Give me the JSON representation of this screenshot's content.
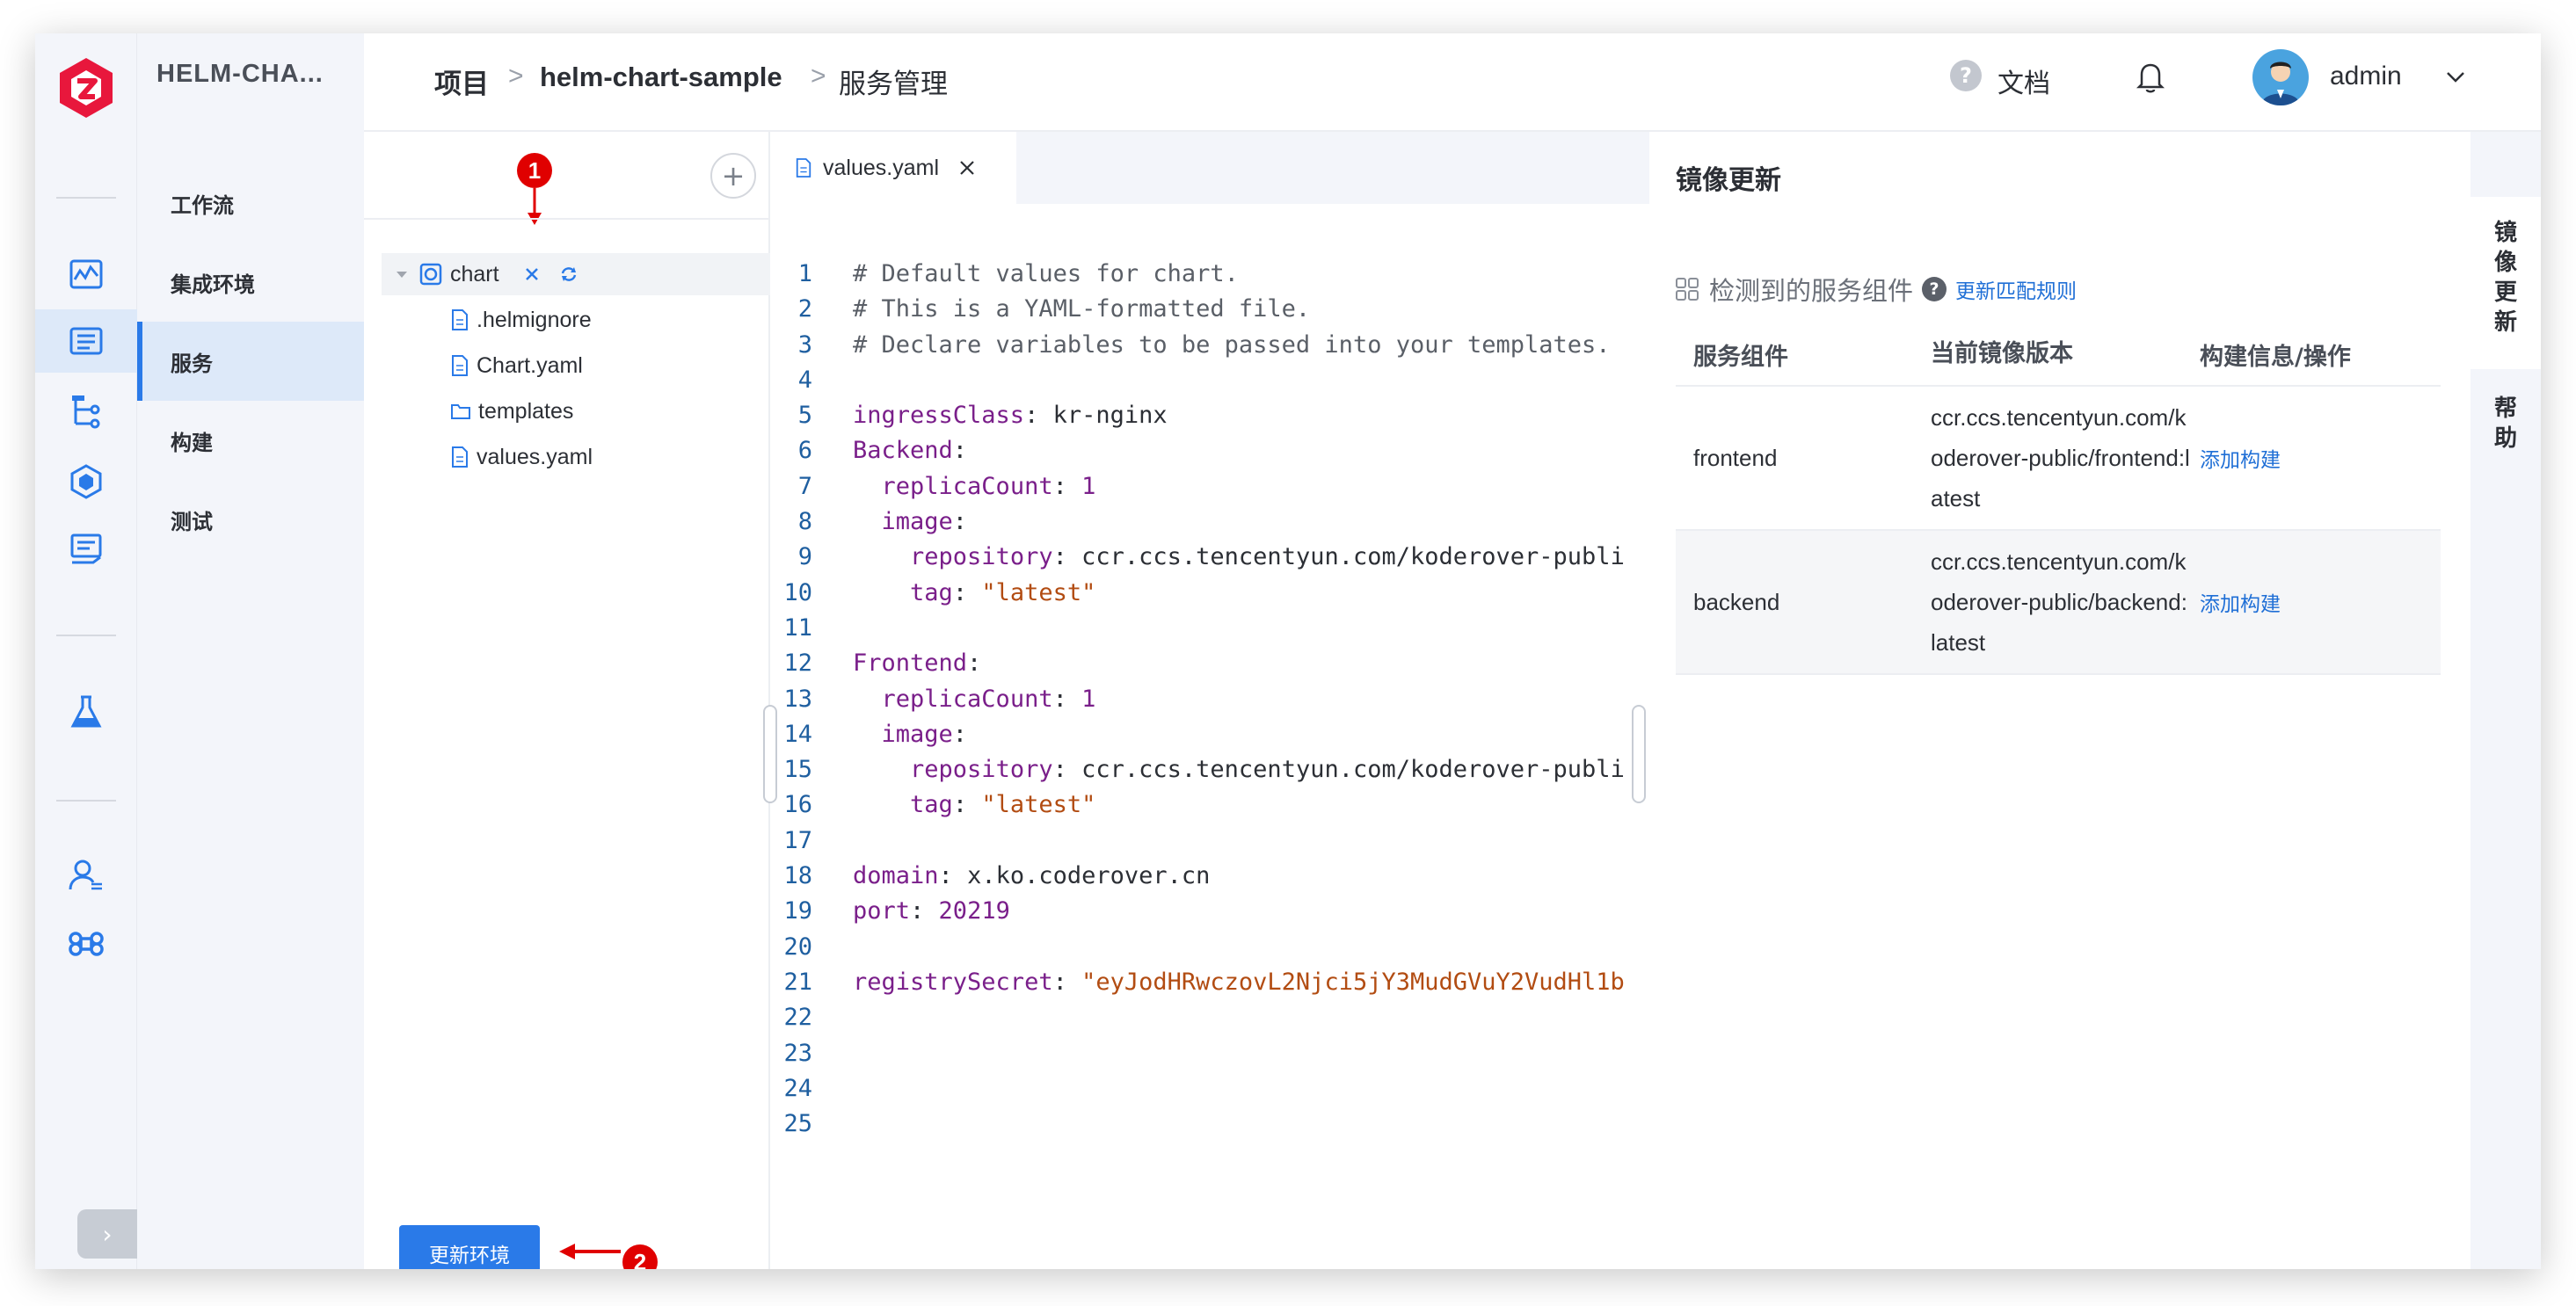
{
  "colors": {
    "accent": "#2a7ae8",
    "link": "#1f6fd6",
    "marker": "#e00000",
    "logo": "#e8173c"
  },
  "project_name": "HELM-CHA...",
  "nav": {
    "items": [
      {
        "label": "工作流",
        "active": false
      },
      {
        "label": "集成环境",
        "active": false
      },
      {
        "label": "服务",
        "active": true
      },
      {
        "label": "构建",
        "active": false
      },
      {
        "label": "测试",
        "active": false
      }
    ]
  },
  "rail": {
    "icons": [
      "dashboard-icon",
      "project-list-icon",
      "tree-icon",
      "cube-icon",
      "delivery-icon",
      "flask-icon",
      "user-icon",
      "command-icon"
    ],
    "expand_label": "›"
  },
  "header": {
    "breadcrumb": [
      "项目",
      "helm-chart-sample",
      "服务管理"
    ],
    "separator": ">",
    "help_glyph": "?",
    "docs_label": "文档",
    "username": "admin"
  },
  "tree": {
    "add_label": "+",
    "root": "chart",
    "files": [
      {
        "name": ".helmignore",
        "type": "file"
      },
      {
        "name": "Chart.yaml",
        "type": "file"
      },
      {
        "name": "templates",
        "type": "folder"
      },
      {
        "name": "values.yaml",
        "type": "file"
      }
    ],
    "update_button": "更新环境",
    "markers": [
      "1",
      "2"
    ]
  },
  "editor": {
    "tab_label": "values.yaml",
    "lines": [
      "# Default values for chart.",
      "# This is a YAML-formatted file.",
      "# Declare variables to be passed into your templates.",
      "",
      "ingressClass: kr-nginx",
      "Backend:",
      "  replicaCount: 1",
      "  image:",
      "    repository: ccr.ccs.tencentyun.com/koderover-publi",
      "    tag: \"latest\"",
      "",
      "Frontend:",
      "  replicaCount: 1",
      "  image:",
      "    repository: ccr.ccs.tencentyun.com/koderover-publi",
      "    tag: \"latest\"",
      "",
      "domain: x.ko.coderover.cn",
      "port: 20219",
      "",
      "registrySecret: \"eyJodHRwczovL2Njci5jY3MudGVuY2VudHl1b",
      "",
      "",
      "",
      ""
    ]
  },
  "image_update": {
    "title": "镜像更新",
    "detected_label": "检测到的服务组件",
    "help_glyph": "?",
    "rule_link": "更新匹配规则",
    "columns": [
      "服务组件",
      "当前镜像版本",
      "构建信息/操作"
    ],
    "rows": [
      {
        "service": "frontend",
        "image": "ccr.ccs.tencentyun.com/koderover-public/frontend:latest",
        "action": "添加构建"
      },
      {
        "service": "backend",
        "image": "ccr.ccs.tencentyun.com/koderover-public/backend:latest",
        "action": "添加构建"
      }
    ]
  },
  "side_tabs": [
    "镜像更新",
    "帮助"
  ]
}
